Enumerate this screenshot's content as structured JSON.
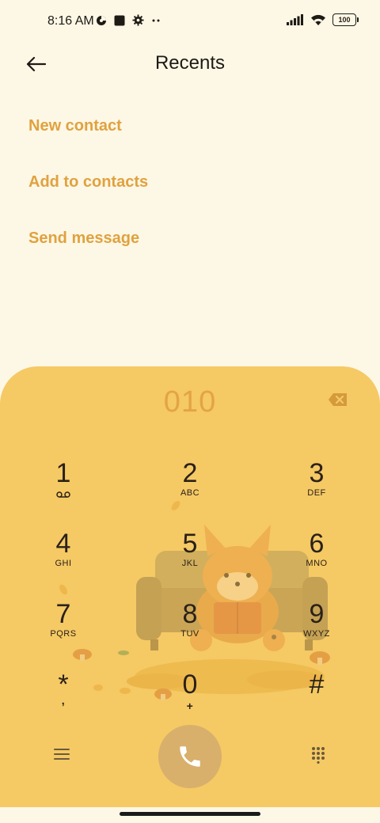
{
  "status_bar": {
    "time": "8:16 AM",
    "left_icons": [
      "data-saver-icon",
      "square-notification-icon",
      "gear-icon",
      "more-dots-icon"
    ],
    "right_icons": [
      "signal-icon",
      "wifi-icon",
      "battery-icon"
    ],
    "battery_level": "100"
  },
  "header": {
    "title": "Recents",
    "back_icon": "back-arrow-icon"
  },
  "actions": [
    {
      "label": "New contact"
    },
    {
      "label": "Add to contacts"
    },
    {
      "label": "Send message"
    }
  ],
  "dialer": {
    "entered_number": "010",
    "keys": [
      {
        "digit": "1",
        "letters": "voicemail-icon"
      },
      {
        "digit": "2",
        "letters": "ABC"
      },
      {
        "digit": "3",
        "letters": "DEF"
      },
      {
        "digit": "4",
        "letters": "GHI"
      },
      {
        "digit": "5",
        "letters": "JKL"
      },
      {
        "digit": "6",
        "letters": "MNO"
      },
      {
        "digit": "7",
        "letters": "PQRS"
      },
      {
        "digit": "8",
        "letters": "TUV"
      },
      {
        "digit": "9",
        "letters": "WXYZ"
      },
      {
        "digit": "*",
        "letters": ","
      },
      {
        "digit": "0",
        "letters": "+"
      },
      {
        "digit": "#",
        "letters": ""
      }
    ],
    "bottom_icons": [
      "menu-icon",
      "phone-icon",
      "dialpad-icon"
    ]
  },
  "colors": {
    "background": "#fdf7e6",
    "dialer_background": "#f5c964",
    "accent": "#e0a23e",
    "call_button": "#d8b06c"
  }
}
